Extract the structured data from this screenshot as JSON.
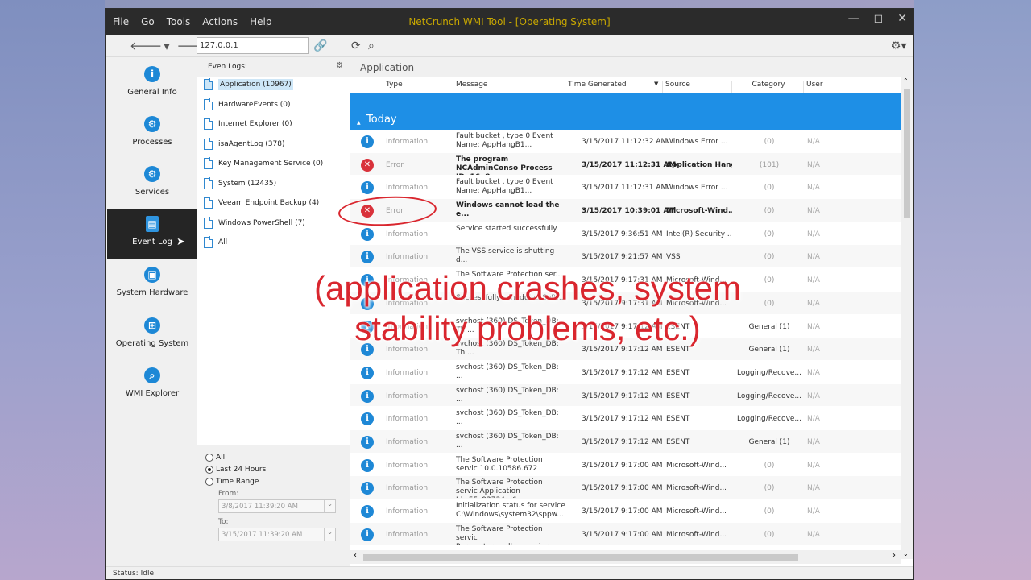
{
  "window": {
    "title": "NetCrunch WMI Tool - [Operating System]",
    "menu": [
      "File",
      "Go",
      "Tools",
      "Actions",
      "Help"
    ],
    "controls": {
      "minimize": "—",
      "maximize": "◻",
      "close": "✕"
    }
  },
  "toolbar": {
    "address": "127.0.0.1"
  },
  "sidebar": {
    "items": [
      {
        "label": "General Info",
        "icon": "info-icon",
        "glyph": "i"
      },
      {
        "label": "Processes",
        "icon": "gear-icon",
        "glyph": "⚙"
      },
      {
        "label": "Services",
        "icon": "gears-icon",
        "glyph": "⚙"
      },
      {
        "label": "Event Log",
        "icon": "document-icon",
        "glyph": "▤",
        "active": true
      },
      {
        "label": "System Hardware",
        "icon": "chip-icon",
        "glyph": "▣"
      },
      {
        "label": "Operating System",
        "icon": "windows-icon",
        "glyph": "⊞"
      },
      {
        "label": "WMI Explorer",
        "icon": "search-icon",
        "glyph": "⌕"
      }
    ]
  },
  "tree": {
    "header": "Even Logs:",
    "items": [
      "Application (10967)",
      "HardwareEvents (0)",
      "Internet Explorer (0)",
      "isaAgentLog (378)",
      "Key Management Service (0)",
      "System (12435)",
      "Veeam Endpoint Backup (4)",
      "Windows PowerShell (7)",
      "All"
    ]
  },
  "filter": {
    "options": [
      "All",
      "Last 24 Hours",
      "Time Range"
    ],
    "selected": 1,
    "from_label": "From:",
    "from": "3/8/2017 11:39:20 AM",
    "to_label": "To:",
    "to": "3/15/2017 11:39:20 AM"
  },
  "main": {
    "title": "Application",
    "columns": [
      "Type",
      "Message",
      "Time Generated",
      "Source",
      "Category",
      "User"
    ],
    "group": "Today",
    "rows": [
      {
        "type": "Information",
        "msg": "Fault bucket , type 0 Event Name: AppHangB1...",
        "time": "3/15/2017 11:12:32 AM",
        "src": "Windows Error ...",
        "cat": "(0)",
        "user": "N/A"
      },
      {
        "type": "Error",
        "msg": "The program NCAdminConso Process ID: 16e8...",
        "time": "3/15/2017 11:12:31 AM",
        "src": "Application Hang",
        "cat": "(101)",
        "user": "N/A",
        "bold": true
      },
      {
        "type": "Information",
        "msg": "Fault bucket , type 0 Event Name: AppHangB1...",
        "time": "3/15/2017 11:12:31 AM",
        "src": "Windows Error ...",
        "cat": "(0)",
        "user": "N/A"
      },
      {
        "type": "Error",
        "msg": "Windows cannot load the e...",
        "time": "3/15/2017 10:39:01 AM",
        "src": "Microsoft-Wind...",
        "cat": "(0)",
        "user": "N/A",
        "bold": true
      },
      {
        "type": "Information",
        "msg": "Service started successfully.",
        "time": "3/15/2017 9:36:51 AM",
        "src": "Intel(R) Security ...",
        "cat": "(0)",
        "user": "N/A"
      },
      {
        "type": "Information",
        "msg": "The VSS service is shutting d...",
        "time": "3/15/2017 9:21:57 AM",
        "src": "VSS",
        "cat": "(0)",
        "user": "N/A"
      },
      {
        "type": "Information",
        "msg": "The Software Protection ser...",
        "time": "3/15/2017 9:17:31 AM",
        "src": "Microsoft-Wind...",
        "cat": "(0)",
        "user": "N/A"
      },
      {
        "type": "Information",
        "msg": "Successfully scheduled Soft...",
        "time": "3/15/2017 9:17:31 AM",
        "src": "Microsoft-Wind...",
        "cat": "(0)",
        "user": "N/A"
      },
      {
        "type": "Information",
        "msg": "svchost (360) DS_Token_DB: Th ...",
        "time": "3/15/2017 9:17:12 AM",
        "src": "ESENT",
        "cat": "General (1)",
        "user": "N/A"
      },
      {
        "type": "Information",
        "msg": "svchost (360) DS_Token_DB: Th ...",
        "time": "3/15/2017 9:17:12 AM",
        "src": "ESENT",
        "cat": "General (1)",
        "user": "N/A"
      },
      {
        "type": "Information",
        "msg": "svchost (360) DS_Token_DB: ...",
        "time": "3/15/2017 9:17:12 AM",
        "src": "ESENT",
        "cat": "Logging/Recove...",
        "user": "N/A"
      },
      {
        "type": "Information",
        "msg": "svchost (360) DS_Token_DB: ...",
        "time": "3/15/2017 9:17:12 AM",
        "src": "ESENT",
        "cat": "Logging/Recove...",
        "user": "N/A"
      },
      {
        "type": "Information",
        "msg": "svchost (360) DS_Token_DB: ...",
        "time": "3/15/2017 9:17:12 AM",
        "src": "ESENT",
        "cat": "Logging/Recove...",
        "user": "N/A"
      },
      {
        "type": "Information",
        "msg": "svchost (360) DS_Token_DB: ...",
        "time": "3/15/2017 9:17:12 AM",
        "src": "ESENT",
        "cat": "General (1)",
        "user": "N/A"
      },
      {
        "type": "Information",
        "msg": "The Software Protection servic 10.0.10586.672",
        "time": "3/15/2017 9:17:00 AM",
        "src": "Microsoft-Wind...",
        "cat": "(0)",
        "user": "N/A"
      },
      {
        "type": "Information",
        "msg": "The Software Protection servic Application Id=55c92734-d6...",
        "time": "3/15/2017 9:17:00 AM",
        "src": "Microsoft-Wind...",
        "cat": "(0)",
        "user": "N/A"
      },
      {
        "type": "Information",
        "msg": "Initialization status for service C:\\Windows\\system32\\sppw...",
        "time": "3/15/2017 9:17:00 AM",
        "src": "Microsoft-Wind...",
        "cat": "(0)",
        "user": "N/A"
      },
      {
        "type": "Information",
        "msg": "The Software Protection servic Parameters:caller=wmiprvse....",
        "time": "3/15/2017 9:17:00 AM",
        "src": "Microsoft-Wind...",
        "cat": "(0)",
        "user": "N/A"
      }
    ]
  },
  "status": "Status: Idle",
  "caption": {
    "line1": "(application crashes, system",
    "line2": "stability problems, etc.)"
  },
  "colors": {
    "accent": "#1e8fe6",
    "error": "#d9323b",
    "annotation": "#d9262e",
    "title": "#c9a800"
  }
}
